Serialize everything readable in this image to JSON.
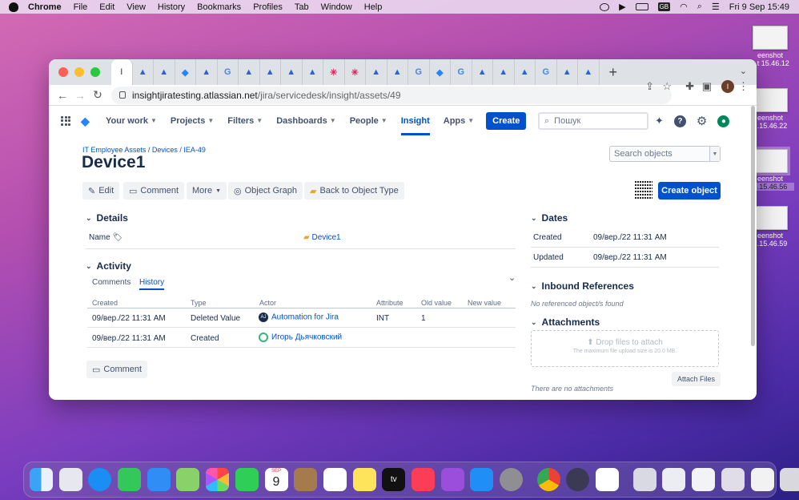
{
  "menubar": {
    "app": "Chrome",
    "items": [
      "File",
      "Edit",
      "View",
      "History",
      "Bookmarks",
      "Profiles",
      "Tab",
      "Window",
      "Help"
    ],
    "input_source": "GB",
    "clock": "Fri 9 Sep  15:49"
  },
  "desktop_files": [
    {
      "line1": "eenshot",
      "line2": "...t 15.46.12"
    },
    {
      "line1": "eenshot",
      "line2": "...15.46.22"
    },
    {
      "line1": "eenshot",
      "line2": "...15.46.56"
    },
    {
      "line1": "eenshot",
      "line2": "...15.46.59"
    }
  ],
  "browser": {
    "active_tab_label": "I",
    "tab_icons": [
      "atlassian",
      "atlassian",
      "jira",
      "atlassian",
      "google",
      "atlassian",
      "atlassian",
      "atlassian",
      "atlassian",
      "slack",
      "slack",
      "atlassian",
      "atlassian",
      "google",
      "jira",
      "google",
      "atlassian",
      "atlassian",
      "atlassian",
      "google",
      "atlassian",
      "atlassian"
    ],
    "new_tab": "+",
    "url_host": "insightjiratesting.atlassian.net",
    "url_path": "/jira/servicedesk/insight/assets/49",
    "profile_initial": "I"
  },
  "jira_nav": {
    "items": [
      {
        "label": "Your work",
        "has_caret": true
      },
      {
        "label": "Projects",
        "has_caret": true
      },
      {
        "label": "Filters",
        "has_caret": true
      },
      {
        "label": "Dashboards",
        "has_caret": true
      },
      {
        "label": "People",
        "has_caret": true
      },
      {
        "label": "Insight",
        "has_caret": false,
        "active": true
      },
      {
        "label": "Apps",
        "has_caret": true
      }
    ],
    "create": "Create",
    "search_placeholder": "Пошук"
  },
  "breadcrumb": [
    "IT Employee Assets",
    "Devices",
    "IEA-49"
  ],
  "page_title": "Device1",
  "object_search_placeholder": "Search objects",
  "actions": {
    "edit": "Edit",
    "comment": "Comment",
    "more": "More",
    "object_graph": "Object Graph",
    "back": "Back to Object Type",
    "create_object": "Create object"
  },
  "details": {
    "heading": "Details",
    "name_label": "Name",
    "name_value": "Device1"
  },
  "activity": {
    "heading": "Activity",
    "tabs": [
      "Comments",
      "History"
    ],
    "active_tab": "History",
    "columns": [
      "Created",
      "Type",
      "Actor",
      "Attribute",
      "Old value",
      "New value"
    ],
    "rows": [
      {
        "created": "09/вер./22 11:31 AM",
        "type": "Deleted Value",
        "actor": "Automation for Jira",
        "actor_initials": "AJ",
        "attribute": "INT",
        "old_value": "1",
        "new_value": ""
      },
      {
        "created": "09/вер./22 11:31 AM",
        "type": "Created",
        "actor": "Игорь Дьячковский",
        "actor_initials": "",
        "attribute": "",
        "old_value": "",
        "new_value": ""
      }
    ],
    "comment_button": "Comment"
  },
  "dates": {
    "heading": "Dates",
    "created_label": "Created",
    "created_value": "09/вер./22 11:31 AM",
    "updated_label": "Updated",
    "updated_value": "09/вер./22 11:31 AM"
  },
  "inbound": {
    "heading": "Inbound References",
    "empty": "No referenced object/s found"
  },
  "attachments": {
    "heading": "Attachments",
    "drop": "Drop files to attach",
    "max_size": "The maximum file upload size is 20.0 MB.",
    "attach_button": "Attach Files",
    "empty": "There are no attachments"
  },
  "dock": {
    "calendar_month": "SEP",
    "calendar_day": "9",
    "tv_label": "tv"
  },
  "colors": {
    "jira_blue": "#0052cc",
    "text_dark": "#172b4d",
    "muted": "#5e6c84",
    "wallpaper_top": "#d46bb4",
    "wallpaper_bottom": "#2c1f85"
  }
}
